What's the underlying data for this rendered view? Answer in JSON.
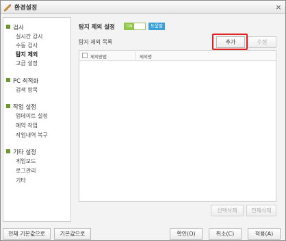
{
  "window": {
    "title": "환경설정",
    "close_glyph": "×"
  },
  "sidebar": {
    "groups": [
      {
        "label": "검사",
        "items": [
          {
            "label": "실시간 감시"
          },
          {
            "label": "수동 검사"
          },
          {
            "label": "탐지 제외",
            "active": true
          },
          {
            "label": "고급 설정"
          }
        ]
      },
      {
        "label": "PC 최적화",
        "items": [
          {
            "label": "검색 항목"
          }
        ]
      },
      {
        "label": "작업 설정",
        "items": [
          {
            "label": "업데이트 설정"
          },
          {
            "label": "예약 작업"
          },
          {
            "label": "작업내역 복구"
          }
        ]
      },
      {
        "label": "기타 설정",
        "items": [
          {
            "label": "게임모드"
          },
          {
            "label": "로그관리"
          },
          {
            "label": "기타"
          }
        ]
      }
    ]
  },
  "main": {
    "section_title": "탐지 제외 설정",
    "toggle": {
      "state": "ON"
    },
    "help_badge": "도움말",
    "list_title": "탐지 제외 목록",
    "buttons": {
      "add": "추가",
      "edit": "수정",
      "delete_selected": "선택삭제",
      "delete_all": "전체삭제"
    },
    "table": {
      "columns": [
        "제외방법",
        "제외명"
      ],
      "rows": []
    }
  },
  "footer": {
    "reset_all": "전체 기본값으로",
    "reset": "기본값으로",
    "ok": "확인(O)",
    "cancel": "취소(C)",
    "apply": "적용(A)"
  },
  "colors": {
    "accent_green": "#8dc63f",
    "highlight_red": "#e02020",
    "help_blue": "#3aa0d8"
  }
}
